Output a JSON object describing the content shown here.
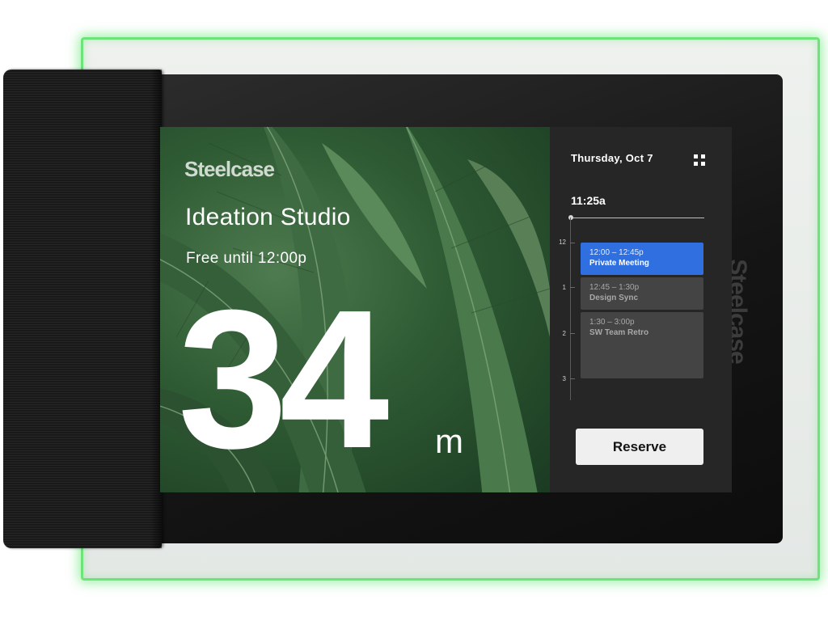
{
  "device": {
    "side_brand": "Steelcase",
    "glow_color": "#6de37a"
  },
  "hero": {
    "brand": "Steelcase",
    "room_name": "Ideation Studio",
    "status": "Free until 12:00p",
    "minutes_value": "34",
    "minutes_unit": "m"
  },
  "panel": {
    "date": "Thursday, Oct 7",
    "menu_icon": "grid-icon",
    "current_time": "11:25a",
    "hour_ticks": [
      "12",
      "1",
      "2",
      "3"
    ],
    "events": [
      {
        "time": "12:00 – 12:45p",
        "title": "Private Meeting",
        "state": "active",
        "color": "#2f6fe0"
      },
      {
        "time": "12:45 – 1:30p",
        "title": "Design Sync",
        "state": "muted",
        "color": "#444444"
      },
      {
        "time": "1:30 – 3:00p",
        "title": "SW Team Retro",
        "state": "muted",
        "color": "#444444"
      }
    ],
    "reserve_label": "Reserve"
  }
}
